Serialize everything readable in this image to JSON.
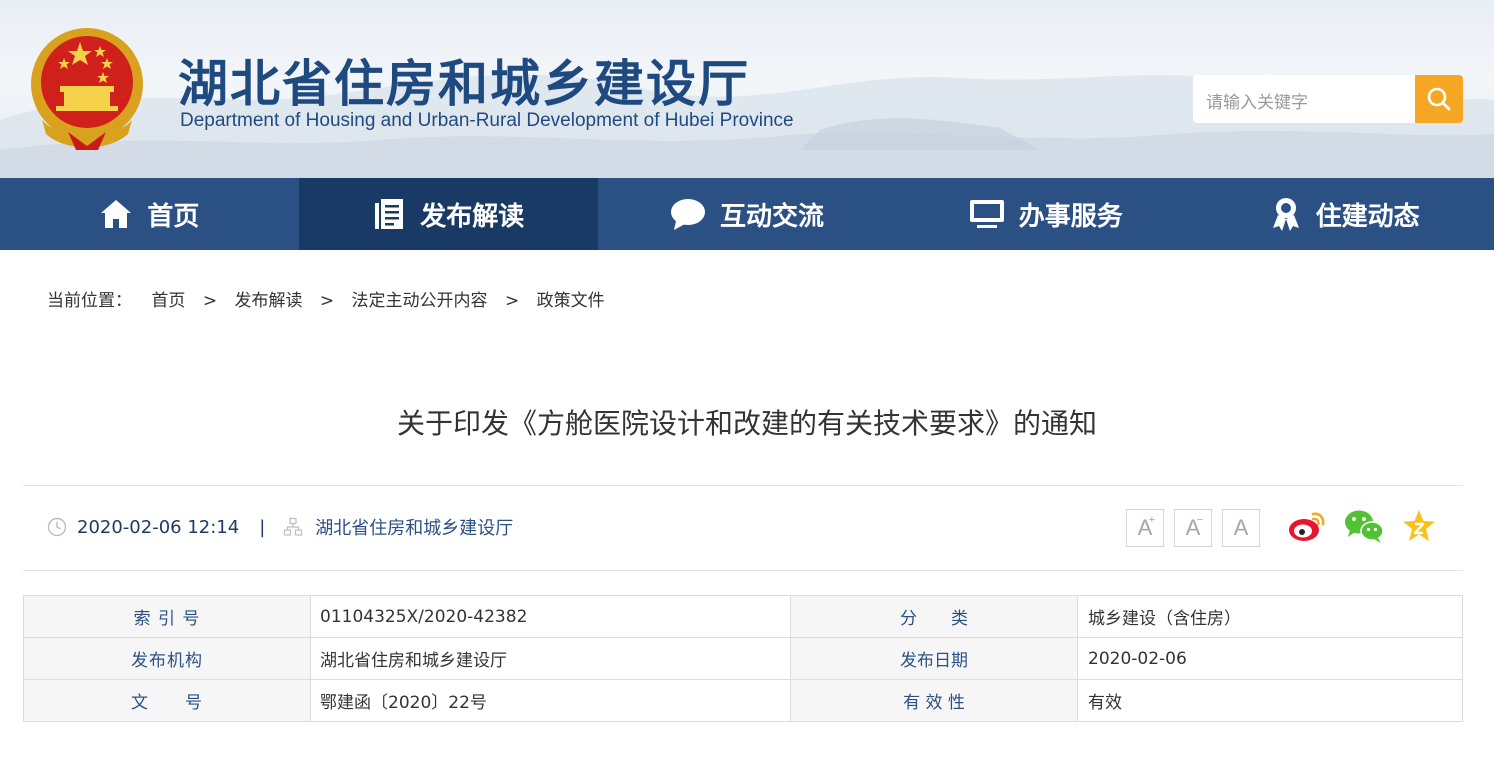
{
  "header": {
    "title_cn": "湖北省住房和城乡建设厅",
    "title_en": "Department of Housing and Urban-Rural Development of Hubei Province",
    "search_placeholder": "请输入关键字",
    "search_icon": "search-icon",
    "emblem": "national-emblem"
  },
  "nav": {
    "items": [
      {
        "label": "首页",
        "icon": "home-icon"
      },
      {
        "label": "发布解读",
        "icon": "document-icon",
        "active": true
      },
      {
        "label": "互动交流",
        "icon": "chat-bubble-icon"
      },
      {
        "label": "办事服务",
        "icon": "monitor-icon"
      },
      {
        "label": "住建动态",
        "icon": "award-icon"
      }
    ]
  },
  "breadcrumb": {
    "prefix": "当前位置：",
    "items": [
      "首页",
      "发布解读",
      "法定主动公开内容",
      "政策文件"
    ],
    "separator": ">"
  },
  "article": {
    "title": "关于印发《方舱医院设计和改建的有关技术要求》的通知",
    "datetime": "2020-02-06 12:14",
    "divider": "|",
    "source": "湖北省住房和城乡建设厅",
    "font_buttons": [
      "A+",
      "A-",
      "A"
    ],
    "share_icons": [
      "weibo-icon",
      "wechat-icon",
      "favorite-star-icon"
    ]
  },
  "info_table": {
    "rows": [
      {
        "k1": "索 引 号",
        "v1": "01104325X/2020-42382",
        "k2": "分　　类",
        "v2": "城乡建设（含住房）"
      },
      {
        "k1": "发布机构",
        "v1": "湖北省住房和城乡建设厅",
        "k2": "发布日期",
        "v2": "2020-02-06"
      },
      {
        "k1": "文　　号",
        "v1": "鄂建函〔2020〕22号",
        "k2": "有 效 性",
        "v2": "有效"
      }
    ]
  },
  "colors": {
    "nav_bg": "#2b5184",
    "nav_active": "#1a3a66",
    "search_button": "#f5a623",
    "title_blue": "#1f4a80"
  }
}
